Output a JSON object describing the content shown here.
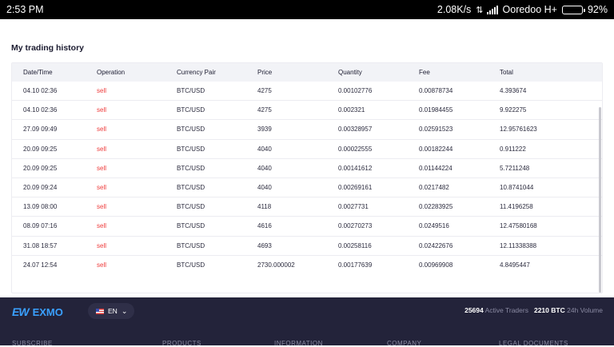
{
  "statusbar": {
    "time": "2:53 PM",
    "speed": "2.08K/s",
    "arrows": "⇅",
    "carrier": "Ooredoo H+",
    "battery_pct": "92%",
    "battery_level": 0.92
  },
  "history": {
    "title": "My trading history",
    "headers": [
      "Date/Time",
      "Operation",
      "Currency Pair",
      "Price",
      "Quantity",
      "Fee",
      "Total"
    ],
    "rows": [
      [
        "04.10 02:36",
        "sell",
        "BTC/USD",
        "4275",
        "0.00102776",
        "0.00878734",
        "4.393674"
      ],
      [
        "04.10 02:36",
        "sell",
        "BTC/USD",
        "4275",
        "0.002321",
        "0.01984455",
        "9.922275"
      ],
      [
        "27.09 09:49",
        "sell",
        "BTC/USD",
        "3939",
        "0.00328957",
        "0.02591523",
        "12.95761623"
      ],
      [
        "20.09 09:25",
        "sell",
        "BTC/USD",
        "4040",
        "0.00022555",
        "0.00182244",
        "0.911222"
      ],
      [
        "20.09 09:25",
        "sell",
        "BTC/USD",
        "4040",
        "0.00141612",
        "0.01144224",
        "5.7211248"
      ],
      [
        "20.09 09:24",
        "sell",
        "BTC/USD",
        "4040",
        "0.00269161",
        "0.0217482",
        "10.8741044"
      ],
      [
        "13.09 08:00",
        "sell",
        "BTC/USD",
        "4118",
        "0.0027731",
        "0.02283925",
        "11.4196258"
      ],
      [
        "08.09 07:16",
        "sell",
        "BTC/USD",
        "4616",
        "0.00270273",
        "0.0249516",
        "12.47580168"
      ],
      [
        "31.08 18:57",
        "sell",
        "BTC/USD",
        "4693",
        "0.00258116",
        "0.02422676",
        "12.11338388"
      ],
      [
        "24.07 12:54",
        "sell",
        "BTC/USD",
        "2730.000002",
        "0.00177639",
        "0.00969908",
        "4.8495447"
      ]
    ]
  },
  "footer": {
    "logo_mark": "EW",
    "logo_text": "EXMO",
    "language": "EN",
    "traders_count": "25694",
    "traders_label": "Active Traders",
    "volume_value": "2210 BTC",
    "volume_label": "24h Volume",
    "nav": [
      "SUBSCRIBE",
      "PRODUCTS",
      "INFORMATION",
      "COMPANY",
      "LEGAL DOCUMENTS"
    ]
  },
  "colors": {
    "sell": "#ee3b3b",
    "footer_bg": "#23233a",
    "brand": "#3aa0ff"
  }
}
